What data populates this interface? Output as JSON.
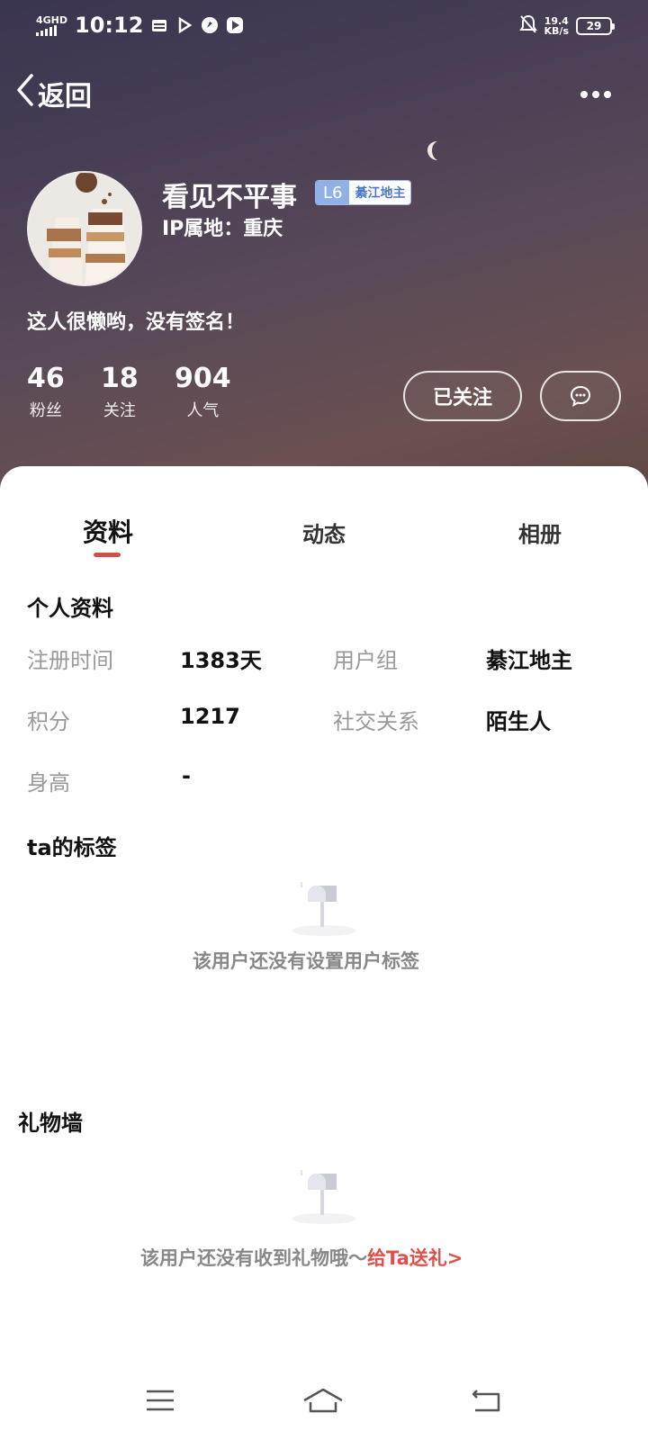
{
  "status_bar": {
    "network": "4GHD",
    "time": "10:12",
    "speed_value": "19.4",
    "speed_unit": "KB/s",
    "battery": "29"
  },
  "header": {
    "back_label": "返回",
    "more_label": "•••"
  },
  "profile": {
    "username": "看见不平事",
    "level": "L6",
    "level_title": "綦江地主",
    "ip_location": "IP属地：重庆",
    "signature": "这人很懒哟，没有签名！",
    "stats": [
      {
        "value": "46",
        "label": "粉丝"
      },
      {
        "value": "18",
        "label": "关注"
      },
      {
        "value": "904",
        "label": "人气"
      }
    ],
    "follow_label": "已关注"
  },
  "tabs": [
    "资料",
    "动态",
    "相册"
  ],
  "details": {
    "title": "个人资料",
    "register_label": "注册时间",
    "register_value": "1383天",
    "group_label": "用户组",
    "group_value": "綦江地主",
    "points_label": "积分",
    "points_value": "1217",
    "relation_label": "社交关系",
    "relation_value": "陌生人",
    "height_label": "身高",
    "height_value": "-"
  },
  "tags": {
    "title": "ta的标签",
    "empty_text": "该用户还没有设置用户标签"
  },
  "gifts": {
    "title": "礼物墙",
    "empty_text": "该用户还没有收到礼物哦～",
    "send_link": "给Ta送礼>"
  },
  "colors": {
    "accent": "#d0504a",
    "badge_blue": "#8fb1e6"
  }
}
